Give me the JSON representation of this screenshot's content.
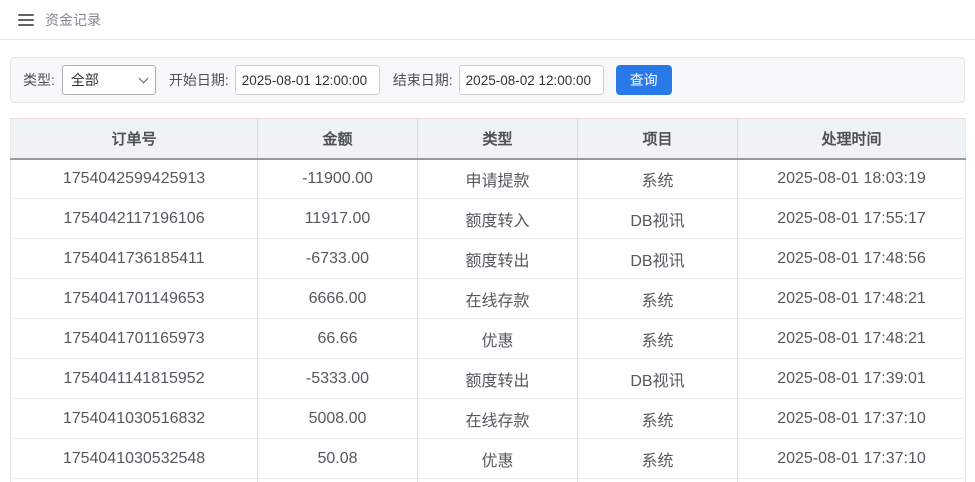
{
  "topbar": {
    "title": "资金记录"
  },
  "filters": {
    "type_label": "类型:",
    "type_value": "全部",
    "start_label": "开始日期:",
    "start_value": "2025-08-01 12:00:00",
    "end_label": "结束日期:",
    "end_value": "2025-08-02 12:00:00",
    "query_label": "查询"
  },
  "table": {
    "columns": [
      "订单号",
      "金额",
      "类型",
      "项目",
      "处理时间"
    ],
    "rows": [
      {
        "order_no": "1754042599425913",
        "amount": "-11900.00",
        "type": "申请提款",
        "project": "系统",
        "time": "2025-08-01 18:03:19"
      },
      {
        "order_no": "1754042117196106",
        "amount": "11917.00",
        "type": "额度转入",
        "project": "DB视讯",
        "time": "2025-08-01 17:55:17"
      },
      {
        "order_no": "1754041736185411",
        "amount": "-6733.00",
        "type": "额度转出",
        "project": "DB视讯",
        "time": "2025-08-01 17:48:56"
      },
      {
        "order_no": "1754041701149653",
        "amount": "6666.00",
        "type": "在线存款",
        "project": "系统",
        "time": "2025-08-01 17:48:21"
      },
      {
        "order_no": "1754041701165973",
        "amount": "66.66",
        "type": "优惠",
        "project": "系统",
        "time": "2025-08-01 17:48:21"
      },
      {
        "order_no": "1754041141815952",
        "amount": "-5333.00",
        "type": "额度转出",
        "project": "DB视讯",
        "time": "2025-08-01 17:39:01"
      },
      {
        "order_no": "1754041030516832",
        "amount": "5008.00",
        "type": "在线存款",
        "project": "系统",
        "time": "2025-08-01 17:37:10"
      },
      {
        "order_no": "1754041030532548",
        "amount": "50.08",
        "type": "优惠",
        "project": "系统",
        "time": "2025-08-01 17:37:10"
      }
    ]
  },
  "icons": {
    "menu": "menu-icon",
    "chevron_down": "chevron-down-icon"
  },
  "colors": {
    "accent_blue": "#2a79e8",
    "header_bg": "#f0f3f5",
    "column_divider_pink": "#e7d6da",
    "row_divider_gray": "#ededed",
    "header_underline": "#97999c"
  }
}
